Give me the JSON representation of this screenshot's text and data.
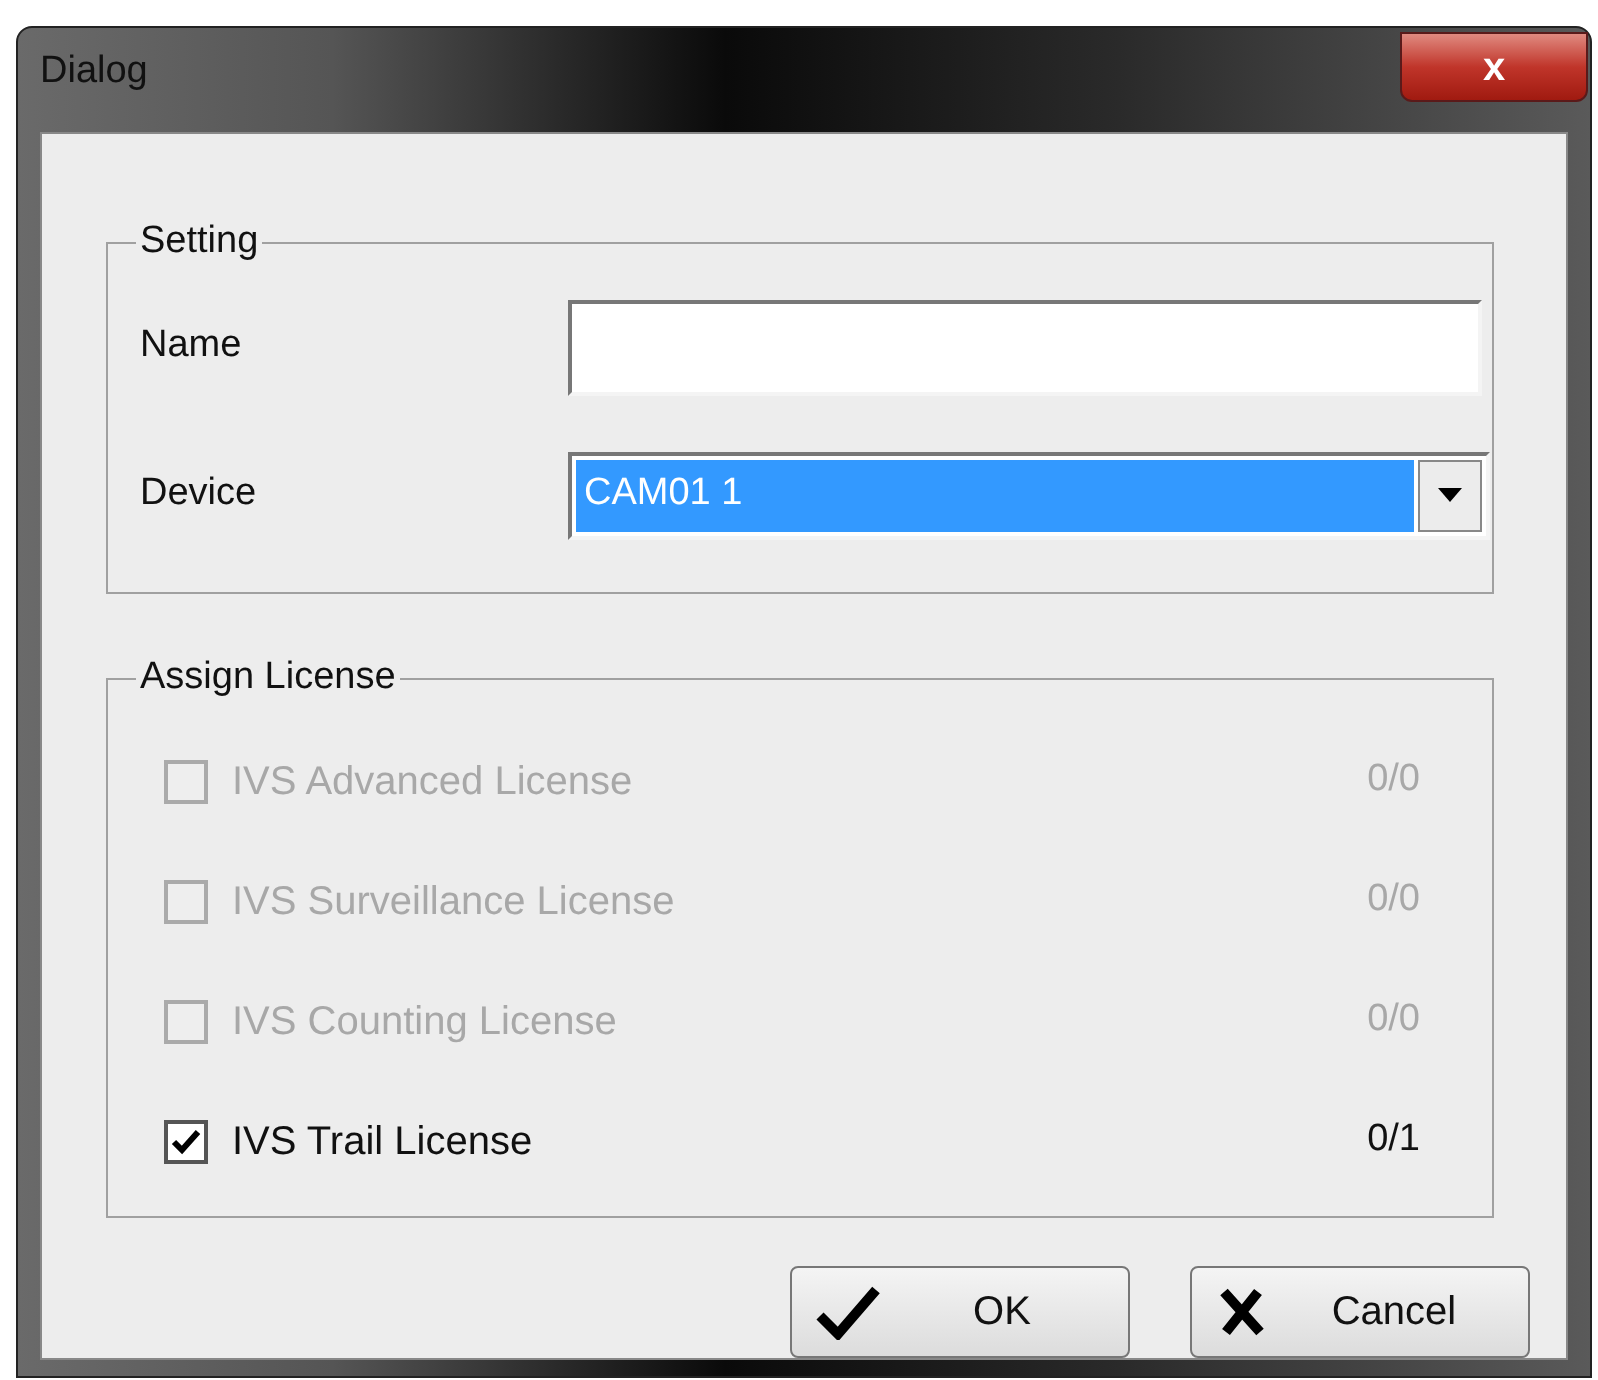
{
  "window": {
    "title": "Dialog",
    "close": "x"
  },
  "setting": {
    "title": "Setting",
    "name_label": "Name",
    "device_label": "Device",
    "device_value": "CAM01 1",
    "device_selected": true
  },
  "license": {
    "title": "Assign License",
    "items": [
      {
        "label": "IVS Advanced License",
        "count": "0/0",
        "checked": false,
        "disabled": true
      },
      {
        "label": "IVS Surveillance License",
        "count": "0/0",
        "checked": false,
        "disabled": true
      },
      {
        "label": "IVS Counting License",
        "count": "0/0",
        "checked": false,
        "disabled": true
      },
      {
        "label": "IVS Trail License",
        "count": "0/1",
        "checked": true,
        "disabled": false
      }
    ]
  },
  "buttons": [
    {
      "kind": "ok",
      "label": "OK"
    },
    {
      "kind": "cancel",
      "label": "Cancel"
    }
  ]
}
